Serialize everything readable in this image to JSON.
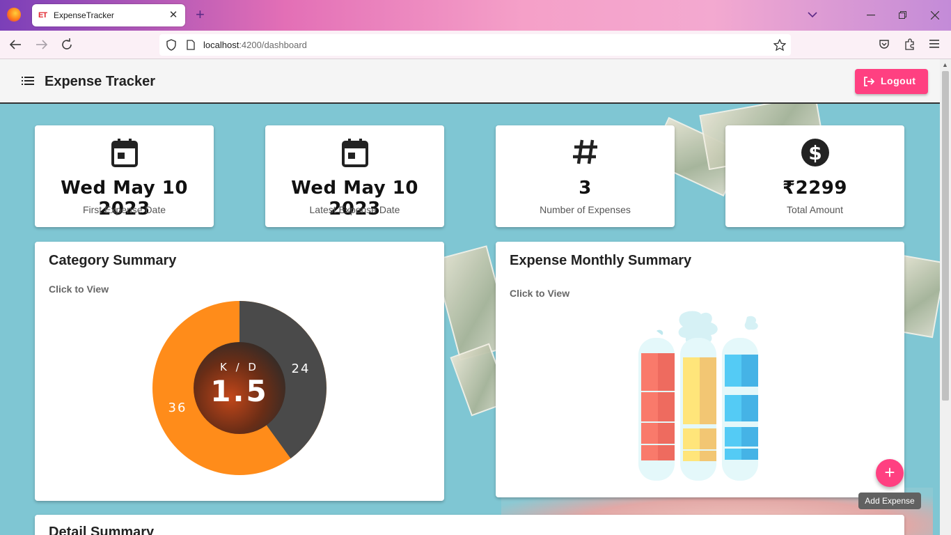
{
  "browser": {
    "tab_title": "ExpenseTracker",
    "tab_favicon": "ET",
    "url_host": "localhost",
    "url_path": ":4200/dashboard",
    "new_tab": "+",
    "close_tab": "✕"
  },
  "header": {
    "title": "Expense Tracker",
    "logout_label": "Logout"
  },
  "stats": [
    {
      "icon": "calendar-icon",
      "value": "Wed May 10 2023",
      "label": "First Expense Date"
    },
    {
      "icon": "calendar-icon",
      "value": "Wed May 10 2023",
      "label": "Latest Expense Date"
    },
    {
      "icon": "hash-icon",
      "value": "3",
      "label": "Number of Expenses"
    },
    {
      "icon": "dollar-icon",
      "value": "₹2299",
      "label": "Total Amount"
    }
  ],
  "category_summary": {
    "title": "Category Summary",
    "subtitle": "Click to View",
    "illustration": {
      "center_label": "K / D",
      "center_value": "1.5",
      "segments": [
        {
          "label": "24",
          "value": 24,
          "color": "#4a4a4a"
        },
        {
          "label": "36",
          "value": 36,
          "color": "#ff8c1a"
        }
      ]
    }
  },
  "monthly_summary": {
    "title": "Expense Monthly Summary",
    "subtitle": "Click to View"
  },
  "detail_summary": {
    "title": "Detail Summary"
  },
  "fab": {
    "icon": "+",
    "tooltip": "Add Expense"
  },
  "colors": {
    "accent": "#ff4081",
    "background": "#7fc6d3"
  }
}
